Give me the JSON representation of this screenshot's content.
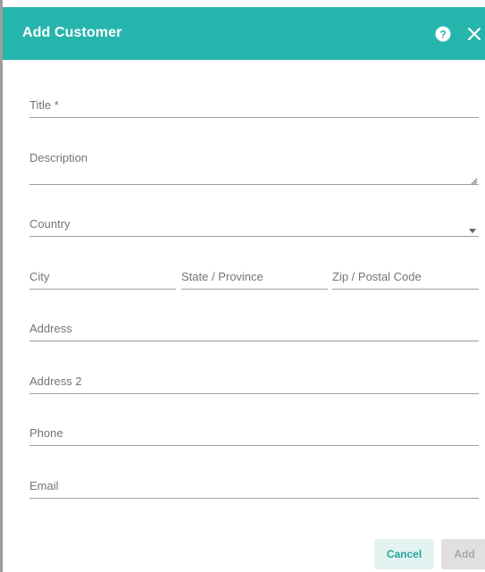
{
  "dialog": {
    "title": "Add Customer",
    "header_color": "#26b5ad",
    "help_icon": "help-circle-icon",
    "close_icon": "close-icon"
  },
  "form": {
    "title_label": "Title *",
    "description_label": "Description",
    "country_label": "Country",
    "city_label": "City",
    "state_label": "State / Province",
    "zip_label": "Zip / Postal Code",
    "address_label": "Address",
    "address2_label": "Address 2",
    "phone_label": "Phone",
    "email_label": "Email"
  },
  "actions": {
    "cancel_label": "Cancel",
    "add_label": "Add"
  }
}
